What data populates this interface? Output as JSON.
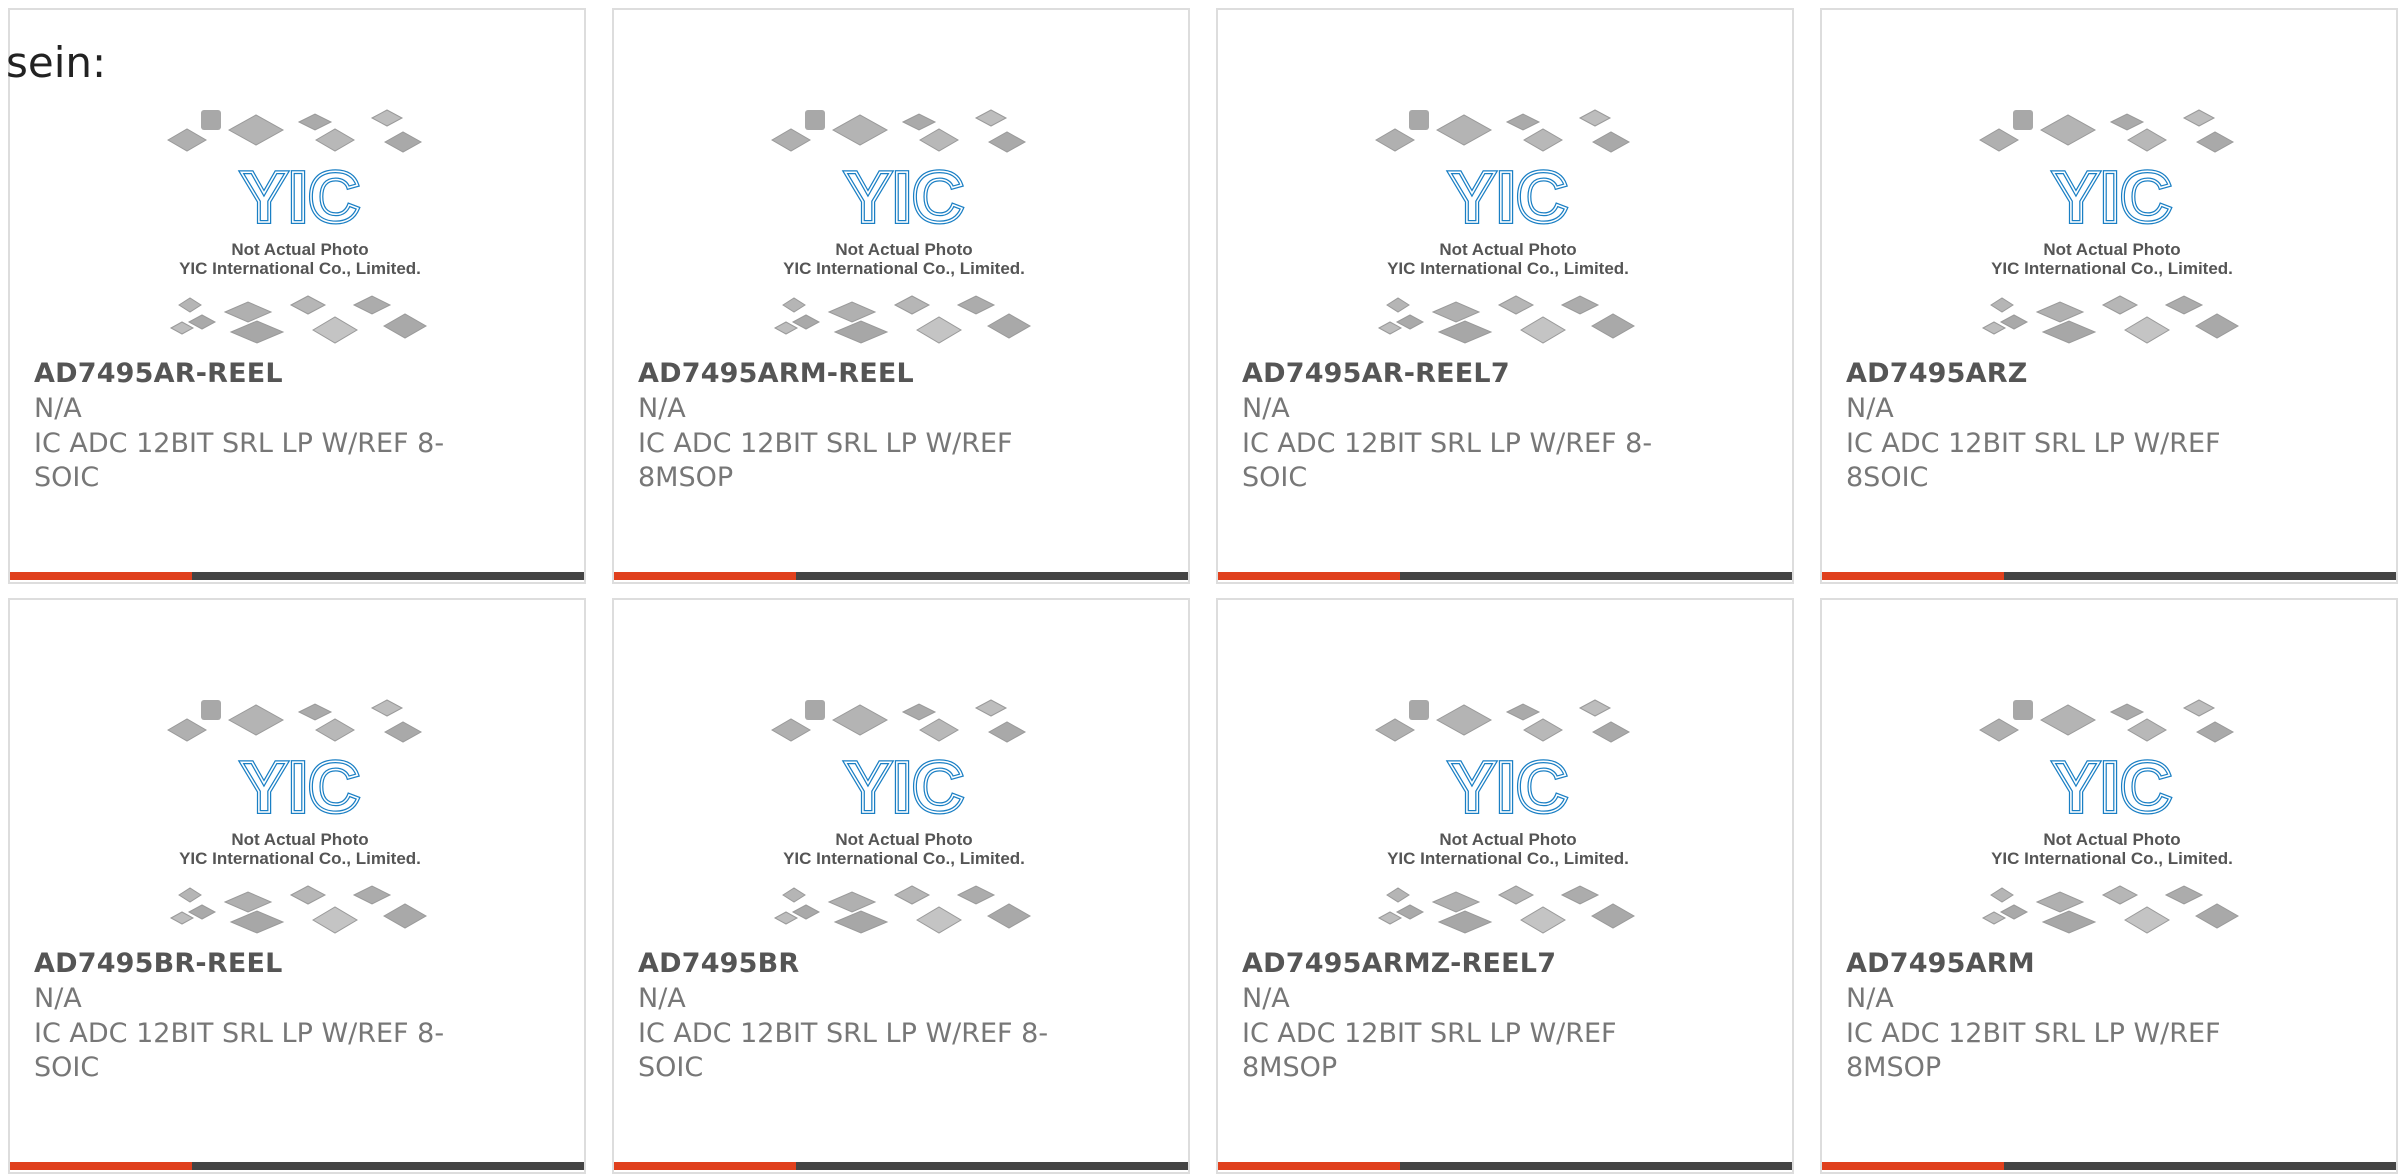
{
  "lead_text": "sein:",
  "photo": {
    "caption_line1": "Not Actual Photo",
    "caption_line2": "YIC International Co., Limited.",
    "logo_text": "YIC",
    "logo_color": "#1a7fc4"
  },
  "colors": {
    "accent": "#e0401d",
    "bar": "#444444",
    "border": "#dddddd"
  },
  "products": [
    {
      "part": "AD7495AR-REEL",
      "mfr": "N/A",
      "desc": "IC ADC 12BIT SRL LP W/REF 8-SOIC"
    },
    {
      "part": "AD7495ARM-REEL",
      "mfr": "N/A",
      "desc": "IC ADC 12BIT SRL LP W/REF 8MSOP"
    },
    {
      "part": "AD7495AR-REEL7",
      "mfr": "N/A",
      "desc": "IC ADC 12BIT SRL LP W/REF 8-SOIC"
    },
    {
      "part": "AD7495ARZ",
      "mfr": "N/A",
      "desc": "IC ADC 12BIT SRL LP W/REF 8SOIC"
    },
    {
      "part": "AD7495BR-REEL",
      "mfr": "N/A",
      "desc": "IC ADC 12BIT SRL LP W/REF 8-SOIC"
    },
    {
      "part": "AD7495BR",
      "mfr": "N/A",
      "desc": "IC ADC 12BIT SRL LP W/REF 8-SOIC"
    },
    {
      "part": "AD7495ARMZ-REEL7",
      "mfr": "N/A",
      "desc": "IC ADC 12BIT SRL LP W/REF 8MSOP"
    },
    {
      "part": "AD7495ARM",
      "mfr": "N/A",
      "desc": "IC ADC 12BIT SRL LP W/REF 8MSOP"
    }
  ]
}
